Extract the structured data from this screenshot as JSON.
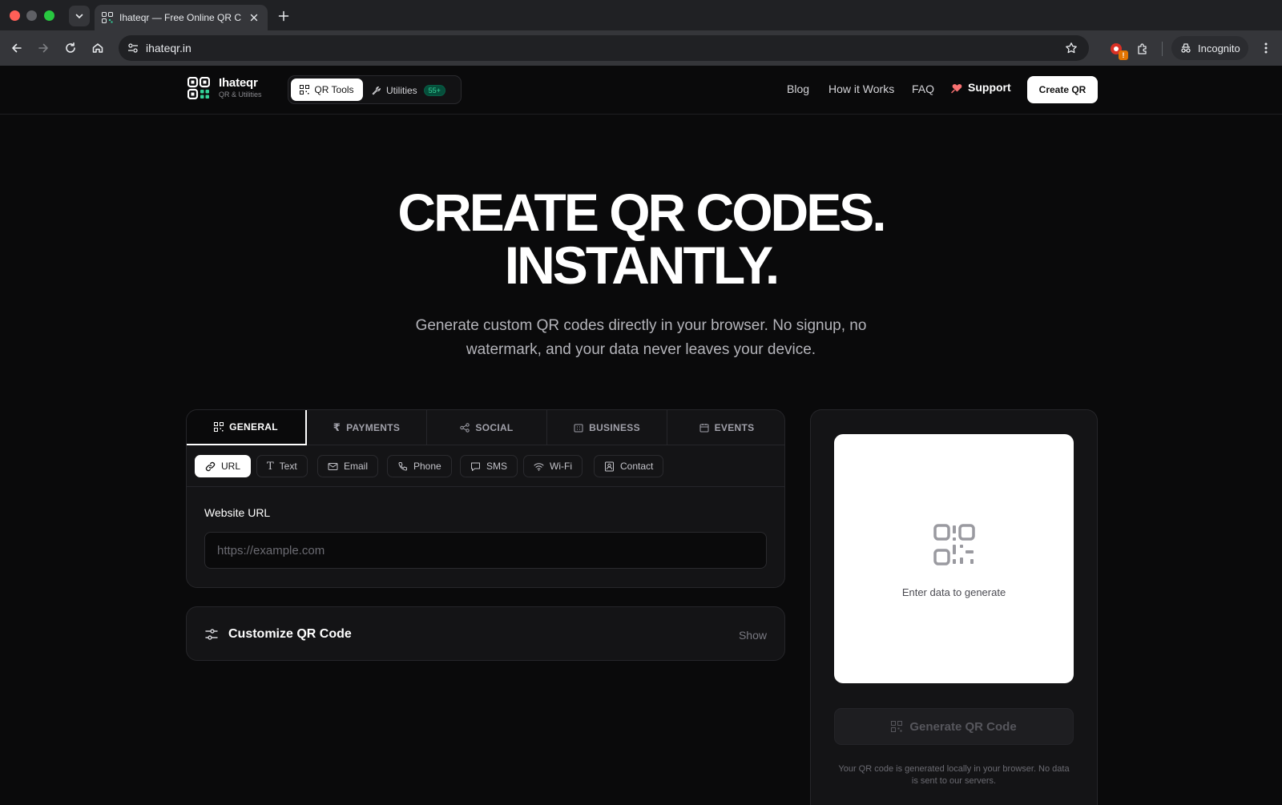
{
  "browser": {
    "tab_title": "Ihateqr — Free Online QR Code Generator",
    "url": "ihateqr.in",
    "incognito_label": "Incognito",
    "extension_badge": "!"
  },
  "header": {
    "brand_name": "Ihateqr",
    "brand_sub": "QR & Utilities",
    "seg_qr_label": "QR Tools",
    "seg_util_label": "Utilities",
    "seg_util_count": "55+",
    "nav": [
      "Blog",
      "How it Works",
      "FAQ"
    ],
    "support_label": "Support",
    "create_label": "Create QR"
  },
  "hero": {
    "line1": "CREATE QR CODES.",
    "line2": "INSTANTLY.",
    "subtitle": "Generate custom QR codes directly in your browser. No signup, no watermark, and your data never leaves your device."
  },
  "categories": [
    "GENERAL",
    "PAYMENTS",
    "SOCIAL",
    "BUSINESS",
    "EVENTS"
  ],
  "types": [
    "URL",
    "Text",
    "Email",
    "Phone",
    "SMS",
    "Wi-Fi",
    "Contact"
  ],
  "form": {
    "label": "Website URL",
    "placeholder": "https://example.com",
    "value": ""
  },
  "customize": {
    "title": "Customize QR Code",
    "toggle": "Show"
  },
  "preview": {
    "empty_text": "Enter data to generate",
    "generate_label": "Generate QR Code",
    "note": "Your QR code is generated locally in your browser. No data is sent to our servers."
  },
  "colors": {
    "page_bg": "#0a0a0b",
    "panel_bg": "#141416",
    "accent_green": "#34d399",
    "support_heart": "#f87171"
  }
}
